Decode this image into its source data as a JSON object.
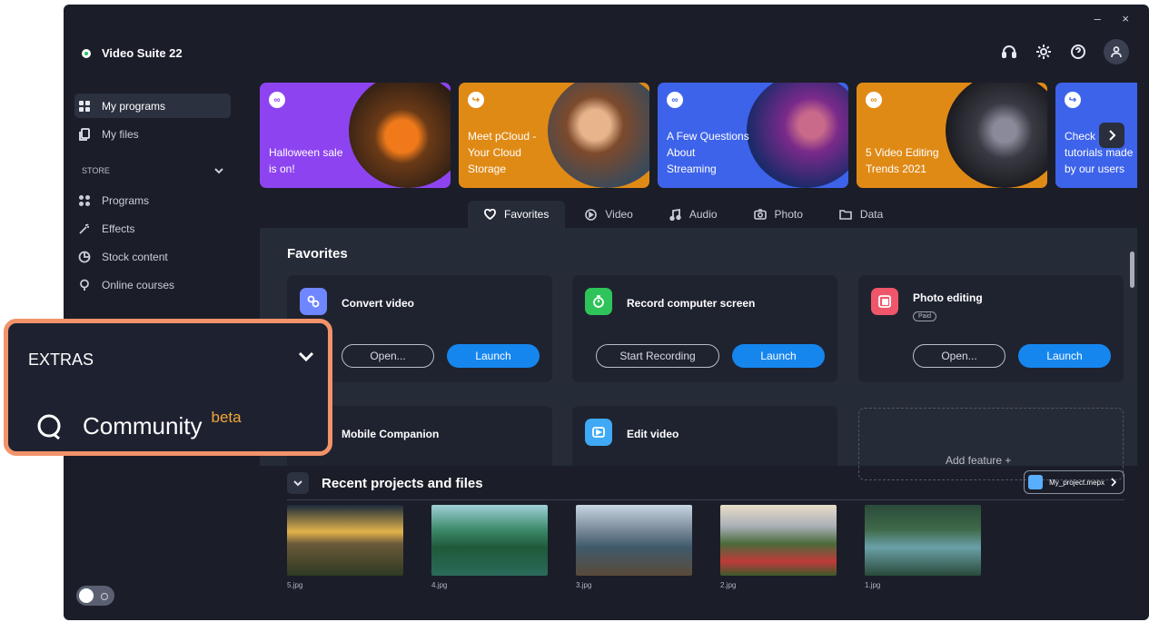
{
  "window": {
    "controls": "– ×"
  },
  "app": {
    "title": "Video Suite 22"
  },
  "sidebar": {
    "main": [
      {
        "label": "My programs"
      },
      {
        "label": "My files"
      }
    ],
    "store_label": "STORE",
    "store_items": [
      {
        "label": "Programs"
      },
      {
        "label": "Effects"
      },
      {
        "label": "Stock content"
      },
      {
        "label": "Online courses"
      }
    ]
  },
  "banners": [
    {
      "text": "Halloween sale\nis on!",
      "color": "#8d44f0"
    },
    {
      "text": "Meet pCloud -\nYour Cloud\nStorage",
      "color": "#e08a16"
    },
    {
      "text": "A Few Questions\nAbout\nStreaming",
      "color": "#3d63ea"
    },
    {
      "text": "5 Video Editing\nTrends 2021",
      "color": "#e08a16"
    },
    {
      "text": "Check out\ntutorials made\nby our users",
      "color": "#3d63ea"
    }
  ],
  "tabs": [
    {
      "label": "Favorites"
    },
    {
      "label": "Video"
    },
    {
      "label": "Audio"
    },
    {
      "label": "Photo"
    },
    {
      "label": "Data"
    }
  ],
  "favorites": {
    "title": "Favorites",
    "cards": [
      {
        "title": "Convert video",
        "secondary": "Open...",
        "primary": "Launch",
        "icon_color": "#6e86ff"
      },
      {
        "title": "Record computer screen",
        "secondary": "Start Recording",
        "primary": "Launch",
        "icon_color": "#2fc45a"
      },
      {
        "title": "Photo editing",
        "badge": "Paid",
        "secondary": "Open...",
        "primary": "Launch",
        "icon_color": "#f0566a"
      },
      {
        "title": "Mobile Companion"
      },
      {
        "title": "Edit video",
        "icon_color": "#3fa9f5"
      }
    ],
    "add_feature": "Add feature +"
  },
  "recent": {
    "title": "Recent projects and files",
    "project_button": "My_project.mepx",
    "files": [
      {
        "name": "5.jpg"
      },
      {
        "name": "4.jpg"
      },
      {
        "name": "3.jpg"
      },
      {
        "name": "2.jpg"
      },
      {
        "name": "1.jpg"
      }
    ]
  },
  "callout": {
    "section": "EXTRAS",
    "item": "Community",
    "badge": "beta",
    "border_color": "#f2936a",
    "badge_color": "#f1a637"
  },
  "colors": {
    "accent": "#1686ef",
    "bg": "#1b1e29",
    "panel": "#262b38"
  }
}
